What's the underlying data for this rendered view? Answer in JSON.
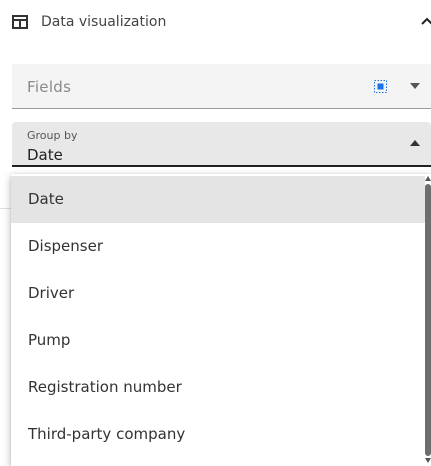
{
  "section": {
    "title": "Data visualization",
    "icon": "table-icon",
    "collapse_icon": "chevron-up-icon"
  },
  "fields": {
    "placeholder": "Fields",
    "select_icon": "select-all-icon",
    "dropdown_icon": "caret-down-icon"
  },
  "group_by": {
    "label": "Group by",
    "value": "Date",
    "dropdown_icon": "caret-up-icon"
  },
  "options": [
    {
      "label": "Date",
      "selected": true
    },
    {
      "label": "Dispenser",
      "selected": false
    },
    {
      "label": "Driver",
      "selected": false
    },
    {
      "label": "Pump",
      "selected": false
    },
    {
      "label": "Registration number",
      "selected": false
    },
    {
      "label": "Third-party company",
      "selected": false
    }
  ],
  "colors": {
    "accent_blue": "#1a73e8",
    "selected_option_bg": "#e4e4e4",
    "scrollbar": "#6e6e6e"
  }
}
